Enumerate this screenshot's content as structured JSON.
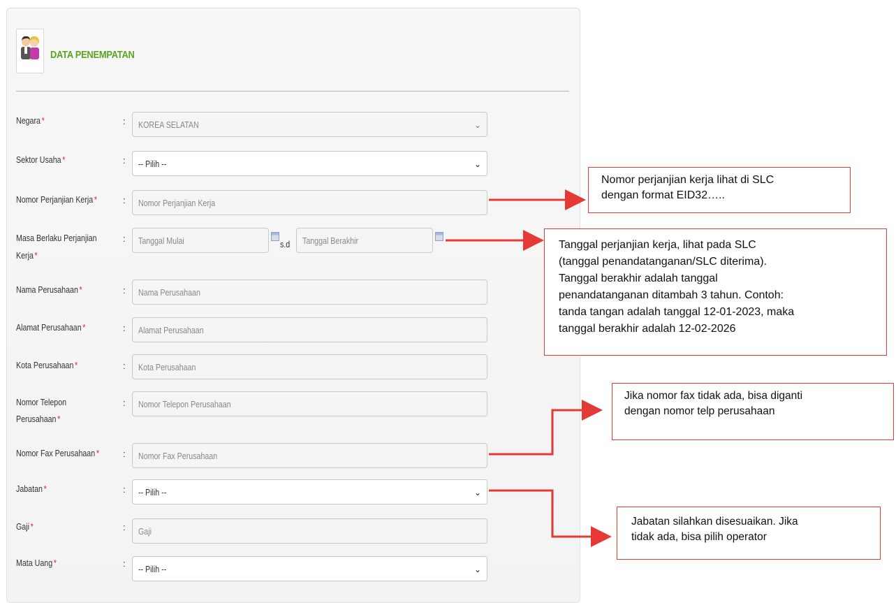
{
  "section": {
    "title": "DATA PENEMPATAN",
    "icon": "users-icon"
  },
  "colon": ":",
  "form": {
    "negara": {
      "label": "Negara",
      "value": "KOREA SELATAN"
    },
    "sektor_usaha": {
      "label": "Sektor Usaha",
      "value": "-- Pilih --"
    },
    "nomor_perjanjian": {
      "label": "Nomor Perjanjian Kerja",
      "placeholder": "Nomor Perjanjian Kerja"
    },
    "masa_berlaku": {
      "label_line1": "Masa Berlaku Perjanjian",
      "label_line2": "Kerja",
      "start_placeholder": "Tanggal Mulai",
      "separator": "s.d",
      "end_placeholder": "Tanggal Berakhir"
    },
    "nama_perusahaan": {
      "label": "Nama Perusahaan",
      "placeholder": "Nama Perusahaan"
    },
    "alamat_perusahaan": {
      "label": "Alamat Perusahaan",
      "placeholder": "Alamat Perusahaan"
    },
    "kota_perusahaan": {
      "label": "Kota Perusahaan",
      "placeholder": "Kota Perusahaan"
    },
    "telepon_perusahaan": {
      "label_line1": "Nomor Telepon",
      "label_line2": "Perusahaan",
      "placeholder": "Nomor Telepon Perusahaan"
    },
    "fax_perusahaan": {
      "label": "Nomor Fax Perusahaan",
      "placeholder": "Nomor Fax Perusahaan"
    },
    "jabatan": {
      "label": "Jabatan",
      "value": "-- Pilih --"
    },
    "gaji": {
      "label": "Gaji",
      "placeholder": "Gaji"
    },
    "mata_uang": {
      "label": "Mata Uang",
      "value": "-- Pilih --"
    }
  },
  "required_mark": "*",
  "callouts": {
    "perjanjian": {
      "line1": "Nomor perjanjian kerja lihat di SLC",
      "line2": "dengan format EID32….."
    },
    "tanggal": {
      "line1": "Tanggal perjanjian kerja, lihat pada SLC",
      "line2": "(tanggal penandatanganan/SLC diterima).",
      "line3": "Tanggal berakhir adalah tanggal",
      "line4": "penandatanganan ditambah 3 tahun. Contoh:",
      "line5": "tanda tangan adalah tanggal 12-01-2023, maka",
      "line6": "tanggal berakhir adalah 12-02-2026"
    },
    "fax": {
      "line1": "Jika nomor fax tidak ada, bisa diganti",
      "line2": "dengan nomor telp perusahaan"
    },
    "jabatan": {
      "line1": "Jabatan silahkan disesuaikan. Jika",
      "line2": "tidak ada, bisa pilih operator"
    }
  },
  "colors": {
    "accent": "#5aa51e",
    "required": "#e02020",
    "annotation": "#e53935"
  }
}
